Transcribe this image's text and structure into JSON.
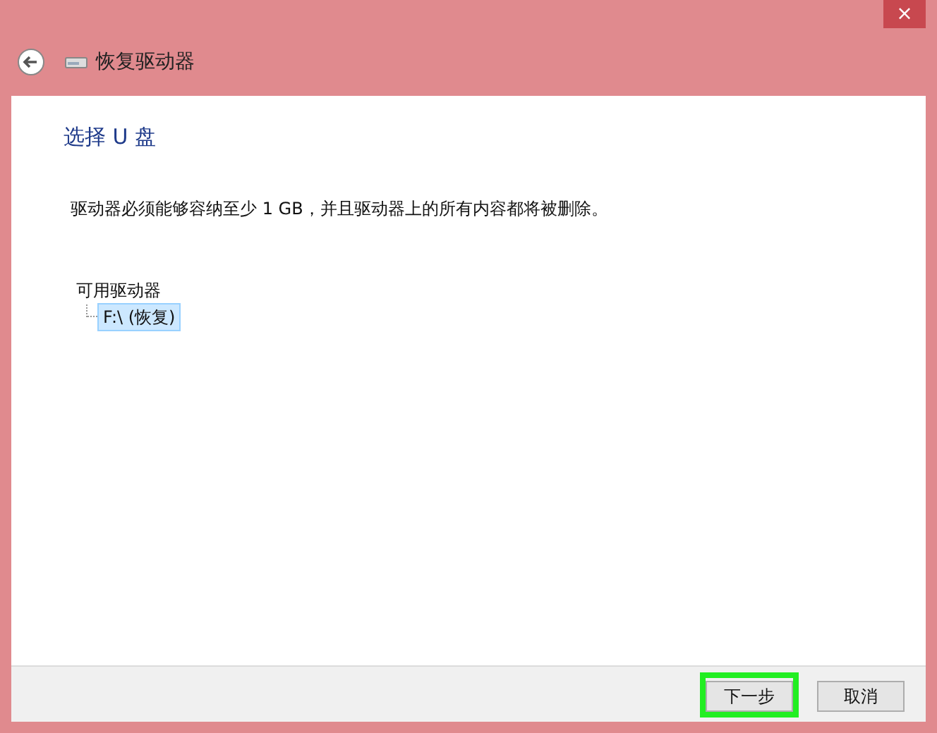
{
  "window": {
    "title": "恢复驱动器",
    "close": "×"
  },
  "heading": "选择 U 盘",
  "description": "驱动器必须能够容纳至少 1 GB，并且驱动器上的所有内容都将被删除。",
  "drives": {
    "label": "可用驱动器",
    "items": [
      {
        "label": "F:\\ (恢复)",
        "selected": true
      }
    ]
  },
  "buttons": [
    {
      "label": "下一步",
      "highlighted": true
    },
    {
      "label": "取消",
      "highlighted": false
    }
  ]
}
